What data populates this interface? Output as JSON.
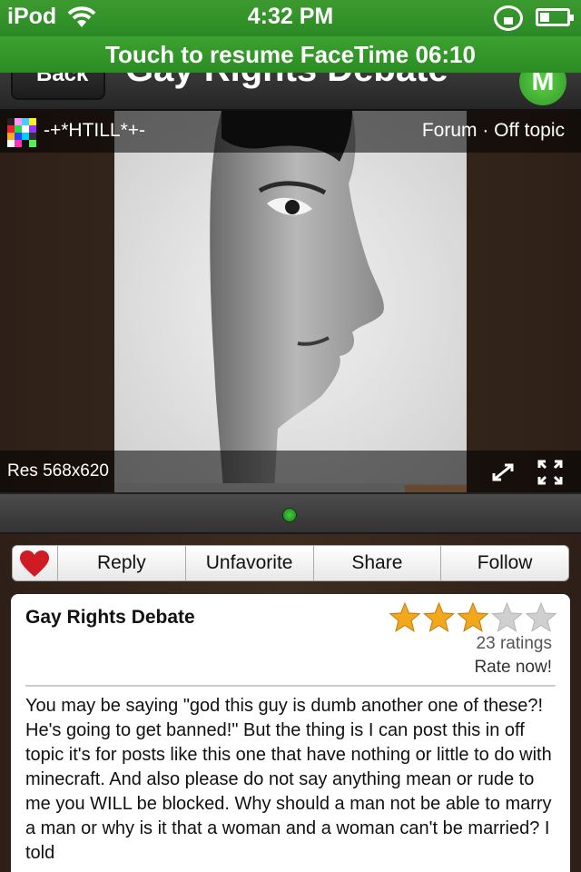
{
  "status": {
    "carrier": "iPod",
    "time": "4:32 PM"
  },
  "banner": {
    "text": "Touch to resume FaceTime 06:10"
  },
  "nav": {
    "back_label": "Back",
    "title": "Gay Rights Debate",
    "menu_label": "M"
  },
  "viewer": {
    "username": "-+*HTILL*+-",
    "breadcrumb": "Forum · Off topic",
    "resolution": "Res 568x620"
  },
  "actions": {
    "reply": "Reply",
    "unfavorite": "Unfavorite",
    "share": "Share",
    "follow": "Follow"
  },
  "post": {
    "title": "Gay Rights Debate",
    "rating": 3,
    "rating_max": 5,
    "ratings_count": "23 ratings",
    "rate_now": "Rate now!",
    "body": "You may be saying \"god this guy is dumb another one of these?! He's going to get banned!\" But the thing is I can post this in off topic it's for posts like this one that have nothing or little to do with minecraft. And also please do not say anything mean or rude to me you WILL be blocked. Why should a man not be able to marry a man or why is it that a woman and a woman can't be married? I told"
  },
  "colors": {
    "accent_green": "#2f9a24",
    "star": "#f2a81d",
    "heart": "#d01b24"
  }
}
